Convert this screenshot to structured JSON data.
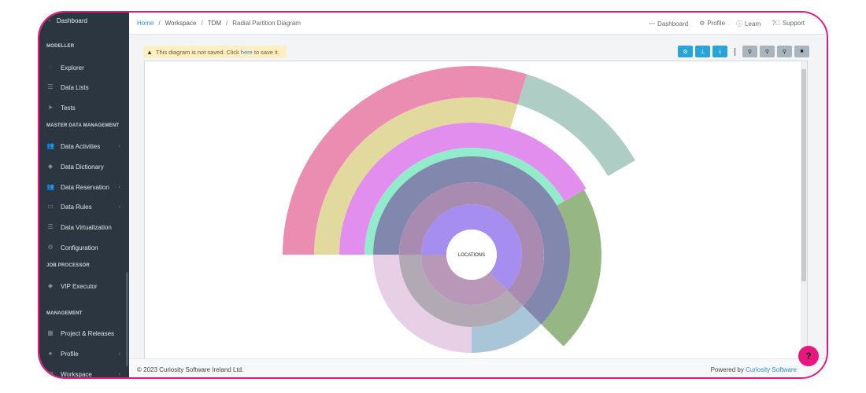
{
  "sidebar": {
    "top_item": "Dashboard",
    "sections": [
      {
        "label": "MODELLER"
      },
      {
        "label": "MASTER DATA MANAGEMENT"
      },
      {
        "label": "JOB PROCESSOR"
      },
      {
        "label": "MANAGEMENT"
      }
    ],
    "items": [
      {
        "label": "Explorer"
      },
      {
        "label": "Data Lists"
      },
      {
        "label": "Tests"
      },
      {
        "label": "Data Activities"
      },
      {
        "label": "Data Dictionary"
      },
      {
        "label": "Data Reservation"
      },
      {
        "label": "Data Rules"
      },
      {
        "label": "Data Virtualization"
      },
      {
        "label": "Configuration"
      },
      {
        "label": "VIP Executor"
      },
      {
        "label": "Project & Releases"
      },
      {
        "label": "Profile"
      },
      {
        "label": "Workspace"
      }
    ]
  },
  "breadcrumb": {
    "home": "Home",
    "items": [
      "Workspace",
      "TDM",
      "Radial Partition Diagram"
    ]
  },
  "topnav": {
    "dashboard": "Dashboard",
    "profile": "Profile",
    "learn": "Learn",
    "support": "Support"
  },
  "alert": {
    "before": "This diagram is not saved. Click",
    "link": "here",
    "after": "to save it."
  },
  "diagram": {
    "center_label": "LOCATIONS",
    "colors": {
      "pink": "#ea8db0",
      "yellow": "#e2d99f",
      "teal_grey": "#aecdc4",
      "magenta": "#e18eee",
      "mint": "#92eccc",
      "green": "#96b783",
      "slate": "#8187ad",
      "mauve": "#a98bb2",
      "violet": "#a58ef0",
      "lilac": "#e7cfe6",
      "grey": "#b1aab5",
      "rose_grey": "#b897b9",
      "light_blue": "#a8c6d8"
    }
  },
  "footer": {
    "copyright": "© 2023 Curiosity Software Ireland Ltd.",
    "powered_prefix": "Powered by",
    "powered_link": "Curiosity Software"
  }
}
